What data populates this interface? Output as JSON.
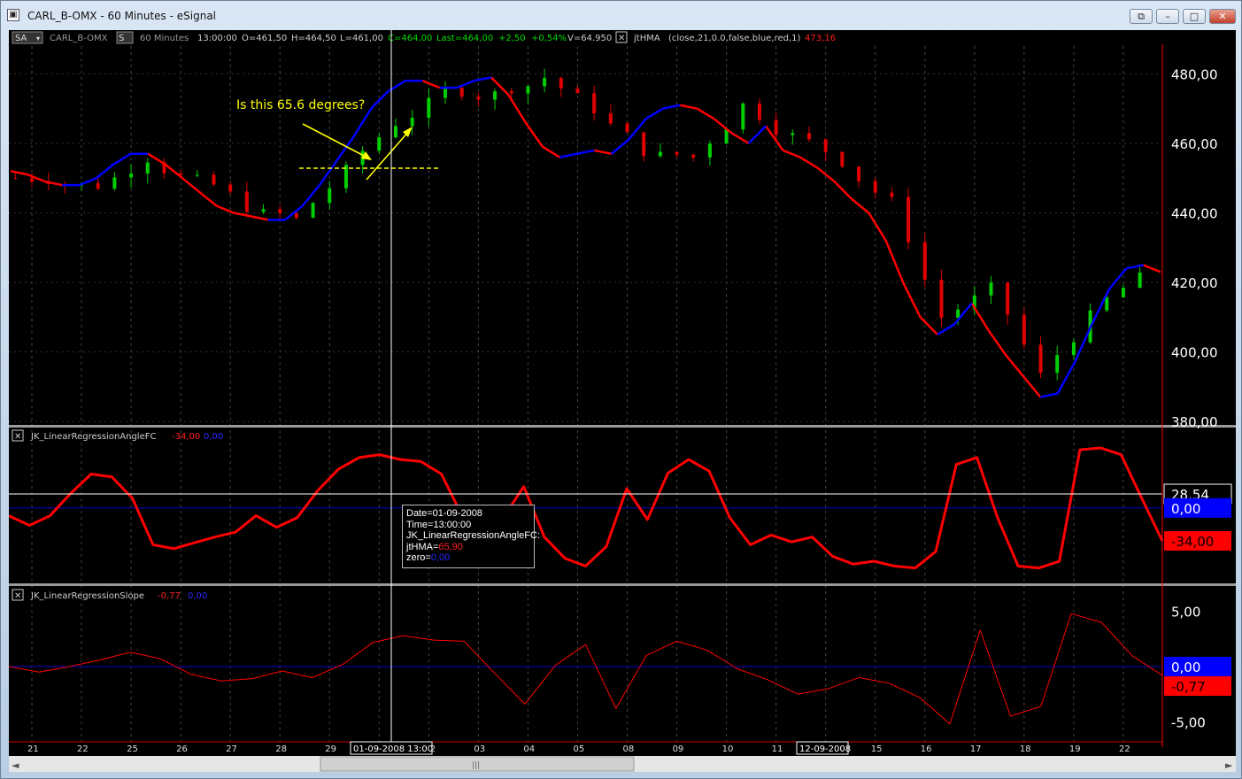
{
  "window": {
    "title": "CARL_B-OMX - 60 Minutes - eSignal"
  },
  "toolbar": {
    "sa": "SA",
    "symbol": "CARL_B-OMX",
    "s_badge": "S",
    "interval": "60 Minutes",
    "time": "13:00:00",
    "open": "O=461,50",
    "high": "H=464,50",
    "low": "L=461,00",
    "close": "C=464,00",
    "last": "Last=464,00",
    "change": "+2,50",
    "change_pct": "+0,54%",
    "volume": "V=64.950",
    "study": "jtHMA",
    "study_params": "(close,21,0.0,false,blue,red,1)",
    "study_value": "473,16"
  },
  "pane2": {
    "label": "JK_LinearRegressionAngleFC",
    "val1": "-34,00",
    "val2": "0,00"
  },
  "pane3": {
    "label": "JK_LinearRegressionSlope",
    "val1": "-0,77",
    "val2": "0,00"
  },
  "annotation": {
    "text": "Is this 65.6 degrees?"
  },
  "tooltip": {
    "date": "Date=01-09-2008",
    "time": "Time=13:00:00",
    "study": "JK_LinearRegressionAngleFC:",
    "jthma_label": "jtHMA=",
    "jthma_value": "65,90",
    "zero_label": "zero=",
    "zero_value": "0,00"
  },
  "xaxis": {
    "active_label": "01-09-2008 13:00",
    "active_label2": "12-09-2008"
  },
  "colors": {
    "up": "#00d000",
    "down": "#e00000",
    "hma_up": "#0000ff",
    "hma_down": "#ff0000",
    "zero_line": "#0000cc",
    "annotation": "#ffff00"
  },
  "chart_data": [
    {
      "type": "candlestick",
      "title": "CARL_B-OMX 60 Minutes",
      "x": [
        "21",
        "22",
        "25",
        "26",
        "27",
        "28",
        "29",
        "01",
        "02",
        "03",
        "04",
        "05",
        "08",
        "09",
        "10",
        "11",
        "12",
        "15",
        "16",
        "17",
        "18",
        "19",
        "22"
      ],
      "yticks": [
        "480,00",
        "460,00",
        "440,00",
        "420,00",
        "400,00",
        "380,00"
      ],
      "ylim": [
        379,
        488
      ],
      "close_by_day": [
        450,
        448,
        456,
        449,
        442,
        438,
        452,
        466,
        475,
        474,
        479,
        470,
        458,
        456,
        471,
        462,
        455,
        443,
        410,
        418,
        393,
        410,
        421
      ],
      "hma": {
        "name": "jtHMA",
        "values": [
          [
            0,
            452
          ],
          [
            1,
            451
          ],
          [
            2,
            449
          ],
          [
            3,
            448
          ],
          [
            4,
            448
          ],
          [
            5,
            450
          ],
          [
            6,
            454
          ],
          [
            7,
            457
          ],
          [
            8,
            457
          ],
          [
            9,
            454
          ],
          [
            10,
            450
          ],
          [
            11,
            446
          ],
          [
            12,
            442
          ],
          [
            13,
            440
          ],
          [
            14,
            439
          ],
          [
            15,
            438
          ],
          [
            16,
            438
          ],
          [
            17,
            442
          ],
          [
            18,
            448
          ],
          [
            19,
            455
          ],
          [
            20,
            462
          ],
          [
            21,
            470
          ],
          [
            22,
            475
          ],
          [
            23,
            478
          ],
          [
            24,
            478
          ],
          [
            25,
            476
          ],
          [
            26,
            476
          ],
          [
            27,
            478
          ],
          [
            28,
            479
          ],
          [
            29,
            474
          ],
          [
            30,
            466
          ],
          [
            31,
            459
          ],
          [
            32,
            456
          ],
          [
            33,
            457
          ],
          [
            34,
            458
          ],
          [
            35,
            457
          ],
          [
            36,
            461
          ],
          [
            37,
            467
          ],
          [
            38,
            470
          ],
          [
            39,
            471
          ],
          [
            40,
            470
          ],
          [
            41,
            467
          ],
          [
            42,
            463
          ],
          [
            43,
            460
          ],
          [
            44,
            465
          ],
          [
            45,
            458
          ],
          [
            46,
            456
          ],
          [
            47,
            453
          ],
          [
            48,
            449
          ],
          [
            49,
            444
          ],
          [
            50,
            440
          ],
          [
            51,
            432
          ],
          [
            52,
            420
          ],
          [
            53,
            410
          ],
          [
            54,
            405
          ],
          [
            55,
            408
          ],
          [
            56,
            414
          ],
          [
            57,
            406
          ],
          [
            58,
            399
          ],
          [
            59,
            393
          ],
          [
            60,
            387
          ],
          [
            61,
            388
          ],
          [
            62,
            397
          ],
          [
            63,
            408
          ],
          [
            64,
            418
          ],
          [
            65,
            424
          ],
          [
            66,
            425
          ],
          [
            67,
            423
          ]
        ]
      }
    },
    {
      "type": "line",
      "title": "JK_LinearRegressionAngleFC",
      "yticks": [
        "28,54",
        "0,00",
        "-34,00"
      ],
      "ylim": [
        -76,
        72
      ],
      "zero_line": 0,
      "cursor_value": 28.54,
      "last_value": -34.0,
      "values": [
        [
          0,
          -8
        ],
        [
          1,
          -18
        ],
        [
          2,
          -8
        ],
        [
          3,
          15
        ],
        [
          4,
          35
        ],
        [
          5,
          32
        ],
        [
          6,
          10
        ],
        [
          7,
          -38
        ],
        [
          8,
          -42
        ],
        [
          9,
          -36
        ],
        [
          10,
          -30
        ],
        [
          11,
          -25
        ],
        [
          12,
          -8
        ],
        [
          13,
          -20
        ],
        [
          14,
          -10
        ],
        [
          15,
          18
        ],
        [
          16,
          40
        ],
        [
          17,
          52
        ],
        [
          18,
          55
        ],
        [
          19,
          50
        ],
        [
          20,
          48
        ],
        [
          21,
          35
        ],
        [
          22,
          -8
        ],
        [
          23,
          -40
        ],
        [
          24,
          -10
        ],
        [
          25,
          22
        ],
        [
          26,
          -30
        ],
        [
          27,
          -52
        ],
        [
          28,
          -60
        ],
        [
          29,
          -40
        ],
        [
          30,
          20
        ],
        [
          31,
          -12
        ],
        [
          32,
          36
        ],
        [
          33,
          50
        ],
        [
          34,
          38
        ],
        [
          35,
          -10
        ],
        [
          36,
          -38
        ],
        [
          37,
          -28
        ],
        [
          38,
          -35
        ],
        [
          39,
          -30
        ],
        [
          40,
          -50
        ],
        [
          41,
          -58
        ],
        [
          42,
          -55
        ],
        [
          43,
          -60
        ],
        [
          44,
          -62
        ],
        [
          45,
          -45
        ],
        [
          46,
          45
        ],
        [
          47,
          52
        ],
        [
          48,
          -10
        ],
        [
          49,
          -60
        ],
        [
          50,
          -62
        ],
        [
          51,
          -55
        ],
        [
          52,
          60
        ],
        [
          53,
          62
        ],
        [
          54,
          55
        ],
        [
          55,
          10
        ],
        [
          56,
          -34
        ]
      ]
    },
    {
      "type": "line",
      "title": "JK_LinearRegressionSlope",
      "yticks": [
        "5,00",
        "0,00",
        "-0,77",
        "-5,00"
      ],
      "ylim": [
        -6.5,
        6.5
      ],
      "zero_line": 0,
      "last_value": -0.77,
      "values": [
        [
          0,
          0
        ],
        [
          1,
          -0.5
        ],
        [
          2,
          0
        ],
        [
          3,
          0.6
        ],
        [
          4,
          1.3
        ],
        [
          5,
          0.7
        ],
        [
          6,
          -0.7
        ],
        [
          7,
          -1.3
        ],
        [
          8,
          -1.1
        ],
        [
          9,
          -0.4
        ],
        [
          10,
          -1.0
        ],
        [
          11,
          0.2
        ],
        [
          12,
          2.2
        ],
        [
          13,
          2.8
        ],
        [
          14,
          2.4
        ],
        [
          15,
          2.3
        ],
        [
          16,
          -0.6
        ],
        [
          17,
          -3.4
        ],
        [
          18,
          0.1
        ],
        [
          19,
          2.0
        ],
        [
          20,
          -3.8
        ],
        [
          21,
          1.0
        ],
        [
          22,
          2.3
        ],
        [
          23,
          1.5
        ],
        [
          24,
          -0.2
        ],
        [
          25,
          -1.2
        ],
        [
          26,
          -2.5
        ],
        [
          27,
          -2.0
        ],
        [
          28,
          -1.0
        ],
        [
          29,
          -1.5
        ],
        [
          30,
          -2.8
        ],
        [
          31,
          -5.2
        ],
        [
          32,
          3.3
        ],
        [
          33,
          -4.5
        ],
        [
          34,
          -3.6
        ],
        [
          35,
          4.8
        ],
        [
          36,
          4.0
        ],
        [
          37,
          1.0
        ],
        [
          38,
          -0.8
        ]
      ]
    }
  ]
}
